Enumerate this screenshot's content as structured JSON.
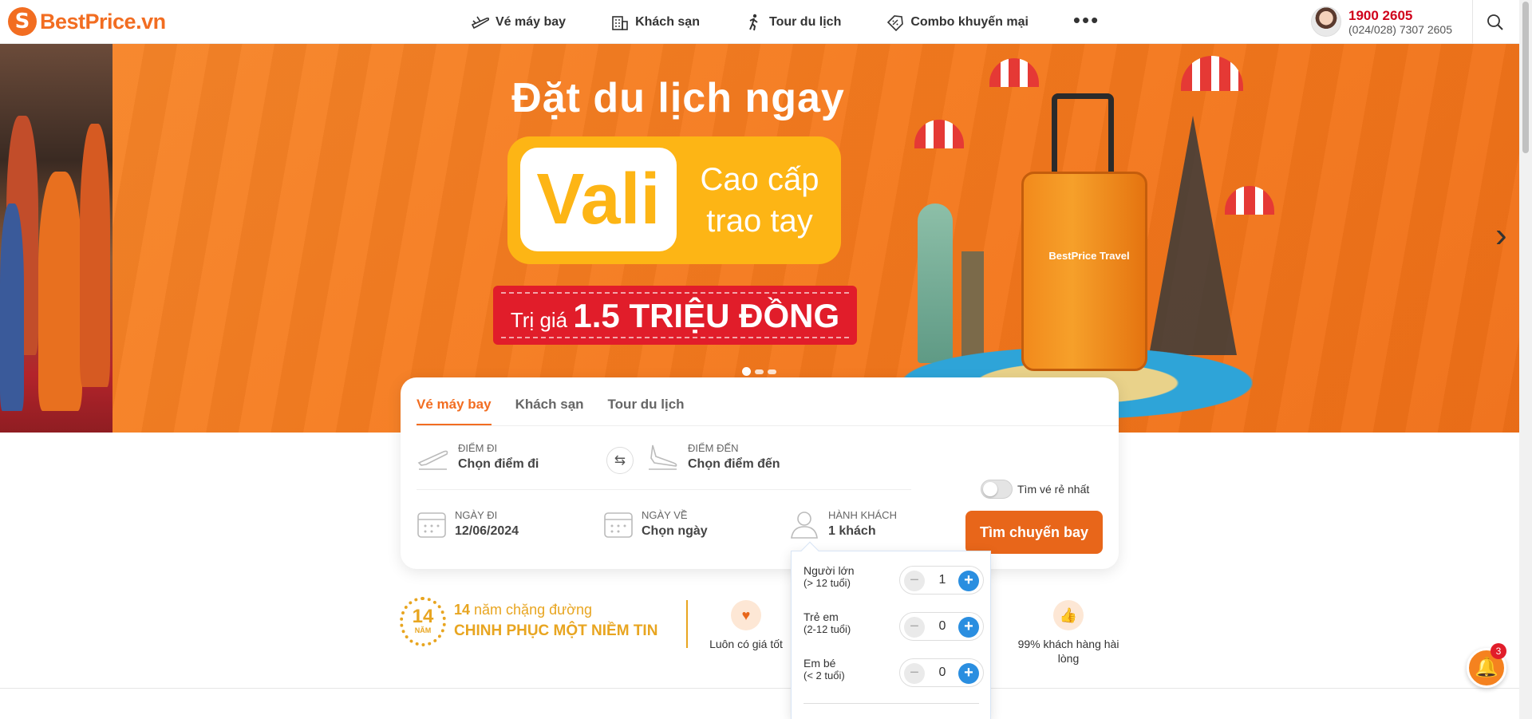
{
  "header": {
    "logo_text": "BestPrice.vn",
    "nav": [
      {
        "label": "Vé máy bay",
        "icon": "plane-icon"
      },
      {
        "label": "Khách sạn",
        "icon": "hotel-icon"
      },
      {
        "label": "Tour du lịch",
        "icon": "hiker-icon"
      },
      {
        "label": "Combo khuyến mại",
        "icon": "discount-tag-icon"
      }
    ],
    "more_label": "•••",
    "hotline_main": "1900 2605",
    "hotline_sub": "(024/028) 7307 2605"
  },
  "banner": {
    "headline": "Đặt du lịch ngay",
    "vali": "Vali",
    "vali_side_1": "Cao cấp",
    "vali_side_2": "trao tay",
    "price_prefix": "Trị giá",
    "price_value": "1.5 TRIỆU ĐỒNG",
    "suitcase_label": "BestPrice Travel",
    "next_arrow": "›"
  },
  "search": {
    "tabs": [
      "Vé máy bay",
      "Khách sạn",
      "Tour du lịch"
    ],
    "active_tab": 0,
    "origin_label": "ĐIỂM ĐI",
    "origin_value": "Chọn điểm đi",
    "dest_label": "ĐIỂM ĐẾN",
    "dest_value": "Chọn điểm đến",
    "depart_label": "NGÀY ĐI",
    "depart_value": "12/06/2024",
    "return_label": "NGÀY VỀ",
    "return_value": "Chọn ngày",
    "pax_label": "HÀNH KHÁCH",
    "pax_value": "1 khách",
    "cheapest_label": "Tìm vé rẻ nhất",
    "cheapest_on": false,
    "submit_label": "Tìm chuyến bay"
  },
  "passengers": [
    {
      "name": "Người lớn",
      "age": "(> 12 tuổi)",
      "count": "1"
    },
    {
      "name": "Trẻ em",
      "age": "(2-12 tuổi)",
      "count": "0"
    },
    {
      "name": "Em bé",
      "age": "(< 2 tuổi)",
      "count": "0"
    }
  ],
  "features": {
    "anniversary_num": "14",
    "anniversary_sub": "NĂM",
    "anniversary_line1_num": "14",
    "anniversary_line1_rest": " năm chặng đường",
    "anniversary_line2": "CHINH PHỤC MỘT NIỀM TIN",
    "items": [
      {
        "label": "Luôn có giá tốt",
        "icon": "price-tag-icon"
      },
      {
        "label": "99% khách hàng hài lòng",
        "icon": "thumbs-up-icon"
      }
    ],
    "badge_99": "99%"
  },
  "notification": {
    "count": "3"
  },
  "colors": {
    "brand": "#f26d21",
    "accent_blue": "#2a8ee0",
    "hotline_red": "#d0021b",
    "gold": "#e8a520"
  }
}
